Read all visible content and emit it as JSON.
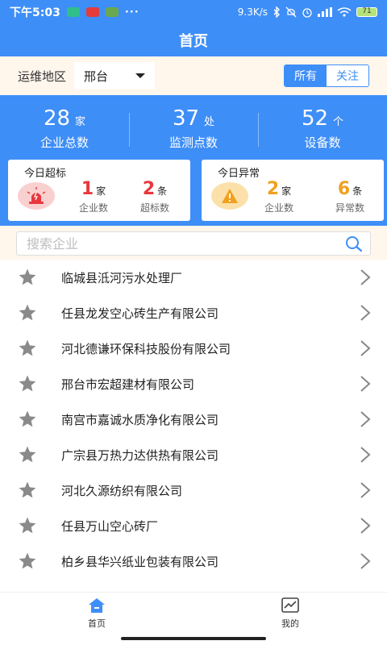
{
  "status_bar": {
    "time": "下午5:03",
    "dots": "···",
    "net_speed": "9.3K/s",
    "battery": "71",
    "app_icons": [
      "shield-app-icon",
      "red-app-icon",
      "leaf-app-icon"
    ],
    "right_icons": [
      "bluetooth-icon",
      "mute-icon",
      "alarm-icon",
      "signal-icon",
      "wifi-icon",
      "battery-icon"
    ]
  },
  "header": {
    "title": "首页"
  },
  "filter": {
    "label": "运维地区",
    "region_value": "邢台",
    "toggle": [
      {
        "label": "所有",
        "active": true
      },
      {
        "label": "关注",
        "active": false
      }
    ]
  },
  "stats": [
    {
      "value": "28",
      "unit": "家",
      "label": "企业总数"
    },
    {
      "value": "37",
      "unit": "处",
      "label": "监测点数"
    },
    {
      "value": "52",
      "unit": "个",
      "label": "设备数"
    }
  ],
  "cards": {
    "exceed": {
      "title": "今日超标",
      "icon": "alarm-light-icon",
      "metrics": [
        {
          "value": "1",
          "unit": "家",
          "label": "企业数"
        },
        {
          "value": "2",
          "unit": "条",
          "label": "超标数"
        }
      ]
    },
    "abnormal": {
      "title": "今日异常",
      "icon": "warning-icon",
      "metrics": [
        {
          "value": "2",
          "unit": "家",
          "label": "企业数"
        },
        {
          "value": "6",
          "unit": "条",
          "label": "异常数"
        }
      ]
    }
  },
  "search": {
    "placeholder": "搜索企业",
    "icon": "search-icon"
  },
  "companies": [
    "临城县泜河污水处理厂",
    "任县龙发空心砖生产有限公司",
    "河北德谦环保科技股份有限公司",
    "邢台市宏超建材有限公司",
    "南宫市嘉诚水质净化有限公司",
    "广宗县万热力达供热有限公司",
    "河北久源纺织有限公司",
    "任县万山空心砖厂",
    "柏乡县华兴纸业包装有限公司"
  ],
  "tabs": [
    {
      "label": "首页",
      "icon": "home-icon",
      "active": true
    },
    {
      "label": "我的",
      "icon": "chart-icon",
      "active": false
    }
  ],
  "colors": {
    "primary": "#3e8ef7",
    "filter_bg": "#fff6ec",
    "exceed_red": "#e8383d",
    "abnormal_orange": "#f0a020",
    "star_gray": "#8a8a8a"
  }
}
